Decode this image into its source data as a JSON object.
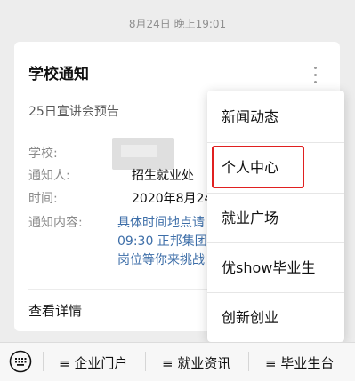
{
  "timestamp": "8月24日 晚上19:01",
  "card": {
    "title": "学校通知",
    "subtitle": "25日宣讲会预告",
    "fields": [
      {
        "label": "学校:",
        "value": ""
      },
      {
        "label": "通知人:",
        "value": "招生就业处"
      },
      {
        "label": "时间:",
        "value": "2020年8月24日"
      },
      {
        "label": "通知内容:",
        "value": ""
      }
    ],
    "content_lines": [
      "具体时间地点请",
      "09:30 正邦集团",
      "岗位等你来挑战"
    ],
    "detail_label": "查看详情"
  },
  "popup_menu": {
    "items": [
      "新闻动态",
      "个人中心",
      "就业广场",
      "优show毕业生",
      "创新创业"
    ],
    "highlighted_index": 1,
    "highlight_color": "#e02020"
  },
  "bottom_bar": {
    "keyboard_icon": "keyboard-icon",
    "menu_icon": "menu-lines-icon",
    "items": [
      "≡ 企业门户",
      "≡ 就业资讯",
      "≡ 毕业生台"
    ]
  }
}
